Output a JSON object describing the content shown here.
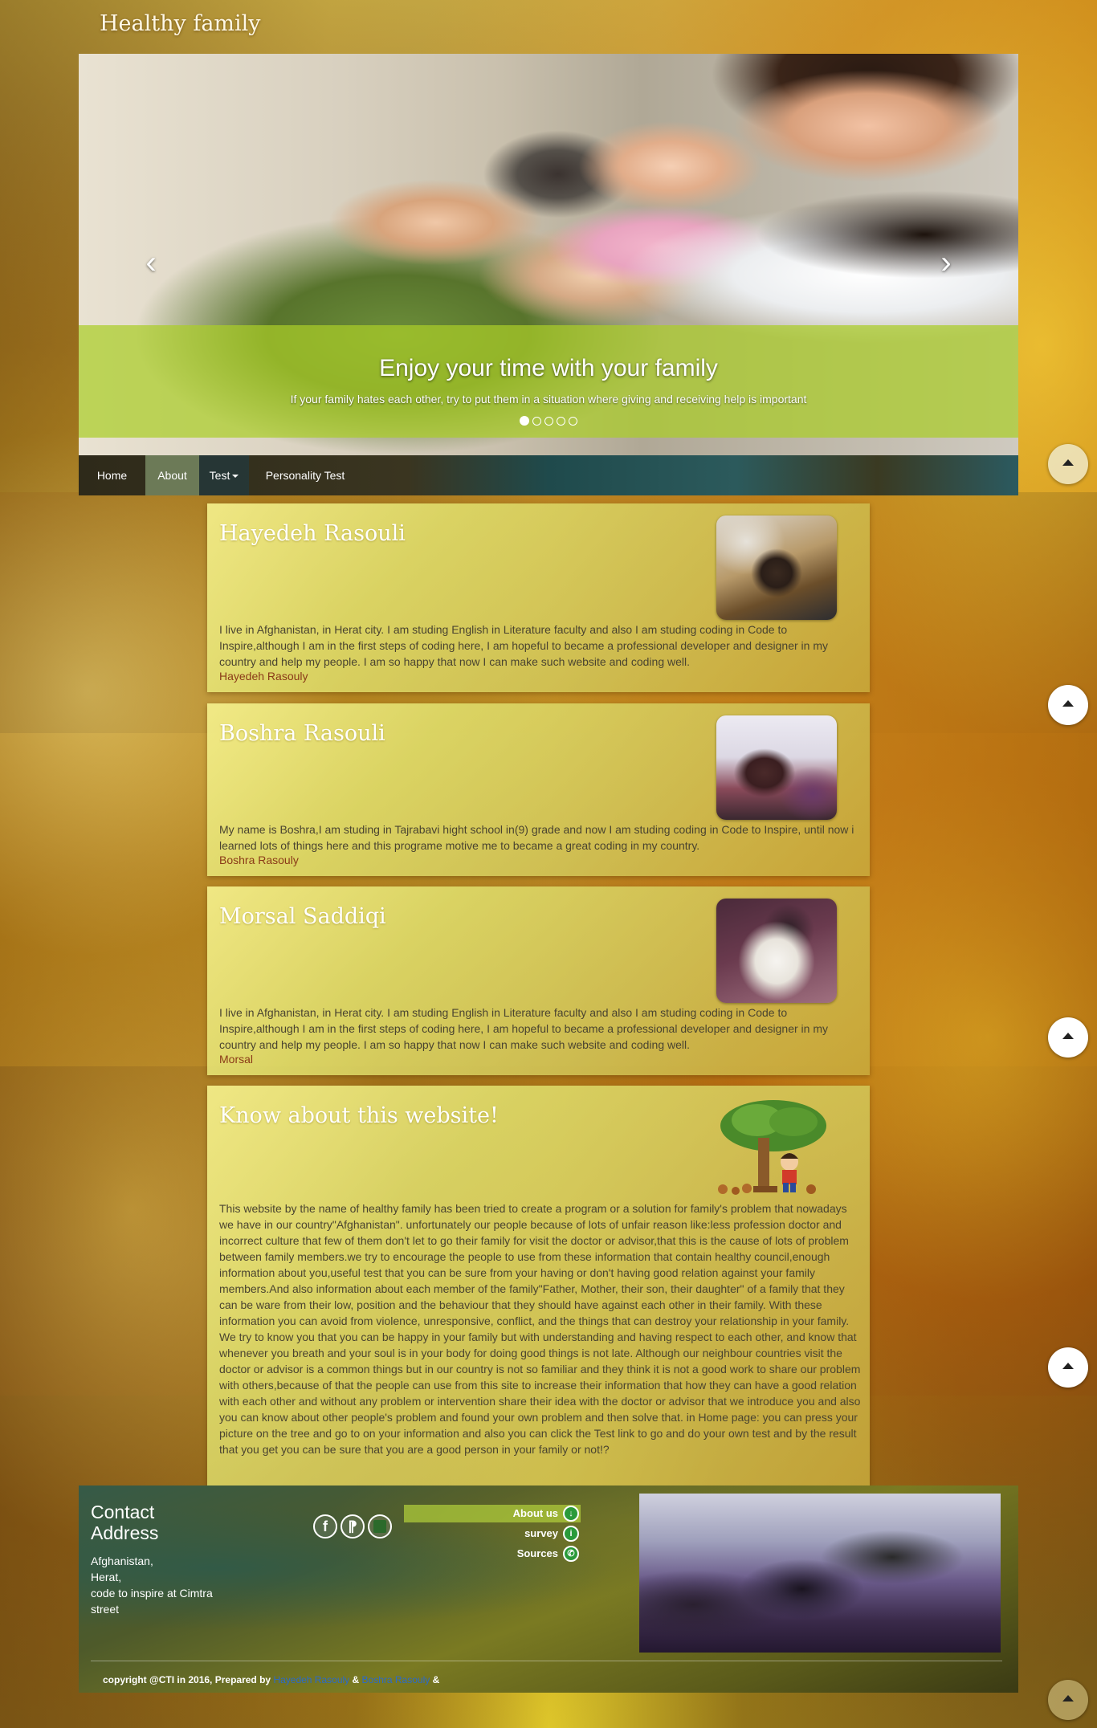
{
  "site": {
    "title": "Healthy family"
  },
  "carousel": {
    "caption_title": "Enjoy your time with your family",
    "caption_text": "If your family hates each other, try to put them in a situation where giving and receiving help is important",
    "slide_count": 5,
    "active_slide": 1
  },
  "nav": {
    "items": [
      {
        "label": "Home"
      },
      {
        "label": "About"
      },
      {
        "label": "Test"
      },
      {
        "label": "Personality Test"
      }
    ],
    "active": "About"
  },
  "cards": [
    {
      "title": "Hayedeh Rasouli",
      "text": "I live in Afghanistan, in Herat city. I am studing English in Literature faculty and also I am studing coding in Code to Inspire,although I am in the first steps of coding here, I am hopeful to became a professional developer and designer in my country and help my people. I am so happy that now I can make such website and coding well.",
      "signature": "Hayedeh Rasouly"
    },
    {
      "title": "Boshra Rasouli",
      "text": "My name is Boshra,I am studing in Tajrabavi hight school in(9) grade and now I am studing coding in Code to Inspire, until now i learned lots of things here and this programe motive me to became a great coding in my country.",
      "signature": "Boshra Rasouly"
    },
    {
      "title": "Morsal Saddiqi",
      "text": "I live in Afghanistan, in Herat city. I am studing English in Literature faculty and also I am studing coding in Code to Inspire,although I am in the first steps of coding here, I am hopeful to became a professional developer and designer in my country and help my people. I am so happy that now I can make such website and coding well.",
      "signature": "Morsal"
    },
    {
      "title": "Know about this website!",
      "text": "This website by the name of healthy family has been tried to create a program or a solution for family's problem that nowadays we have in our country\"Afghanistan\". unfortunately our people because of lots of unfair reason like:less profession doctor and incorrect culture that few of them don't let to go their family for visit the doctor or advisor,that this is the cause of lots of problem between family members.we try to encourage the people to use from these information that contain healthy council,enough information about you,useful test that you can be sure from your having or don't having good relation against your family members.And also information about each member of the family\"Father, Mother, their son, their daughter\" of a family that they can be ware from their low, position and the behaviour that they should have against each other in their family. With these information you can avoid from violence, unresponsive, conflict, and the things that can destroy your relationship in your family. We try to know you that you can be happy in your family but with understanding and having respect to each other, and know that whenever you breath and your soul is in your body for doing good things is not late. Although our neighbour countries visit the doctor or advisor is a common things but in our country is not so familiar and they think it is not a good work to share our problem with others,because of that the people can use from this site to increase their information that how they can have a good relation with each other and without any problem or intervention share their idea with the doctor or advisor that we introduce you and also you can know about other people's problem and found your own problem and then solve that. in Home page: you can press your picture on the tree and go to on your information and also you can click the Test link to go and do your own test and by the result that you get you can be sure that you are a good person in your family or not!?"
    }
  ],
  "footer": {
    "contact_title": "Contact Address",
    "address_lines": [
      "Afghanistan,",
      "Herat,",
      "code to inspire at Cimtra street"
    ],
    "links": [
      {
        "label": "About us",
        "icon": "download-icon"
      },
      {
        "label": "survey",
        "icon": "info-icon"
      },
      {
        "label": "Sources",
        "icon": "whatsapp-icon"
      }
    ],
    "social": [
      {
        "icon": "facebook-icon",
        "glyph": "f"
      },
      {
        "icon": "twitter-icon",
        "glyph": "t"
      },
      {
        "icon": "app-icon",
        "glyph": ""
      }
    ],
    "copyright_prefix": "copyright @CTI in 2016, Prepared by",
    "author1": "Hayedeh Rasouly",
    "separator1": "&",
    "author2": "Boshra Rasouly",
    "separator2": "&"
  },
  "colors": {
    "caption_band": "#aacd28",
    "nav_active": "#6c7a57",
    "signature": "#8a3a18",
    "link_highlight": "#b4d23c"
  }
}
